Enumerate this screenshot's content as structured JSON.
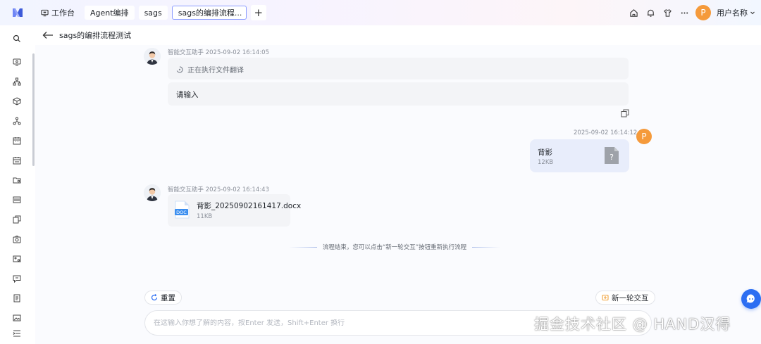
{
  "topbar": {
    "tabs": [
      {
        "label": "工作台",
        "icon": "monitor-icon"
      },
      {
        "label": "Agent编排"
      },
      {
        "label": "sags"
      },
      {
        "label": "sags的编排流程..."
      }
    ],
    "add_tab_label": "+",
    "user": {
      "avatar_letter": "P",
      "name": "用户名称"
    }
  },
  "page": {
    "title": "sags的编排流程测试"
  },
  "chat": {
    "messages": [
      {
        "sender": "智能交互助手",
        "time": "2025-09-02 16:14:05",
        "status": "正在执行文件翻译",
        "text": "请输入"
      },
      {
        "time": "2025-09-02 16:14:12",
        "avatar_letter": "P",
        "file": {
          "name": "背影",
          "size": "12KB",
          "icon_glyph": "?"
        }
      },
      {
        "sender": "智能交互助手",
        "time": "2025-09-02 16:14:43",
        "file": {
          "name": "背影_20250902161417.docx",
          "size": "11KB",
          "icon_label": "DOC"
        }
      }
    ],
    "end_note": "流程结束，您可以点击“新一轮交互”按钮重新执行流程"
  },
  "actions": {
    "reset_label": "重置",
    "new_round_label": "新一轮交互"
  },
  "input": {
    "placeholder": "在这输入你想了解的内容，按Enter 发送，Shift+Enter 换行",
    "value": ""
  },
  "watermark": "掘金技术社区 @ HAND汉得",
  "colors": {
    "accent": "#2c6ef2",
    "user_avatar": "#f59a3b",
    "user_bubble": "#e8edfb",
    "doc_blue": "#3a8ef0"
  }
}
